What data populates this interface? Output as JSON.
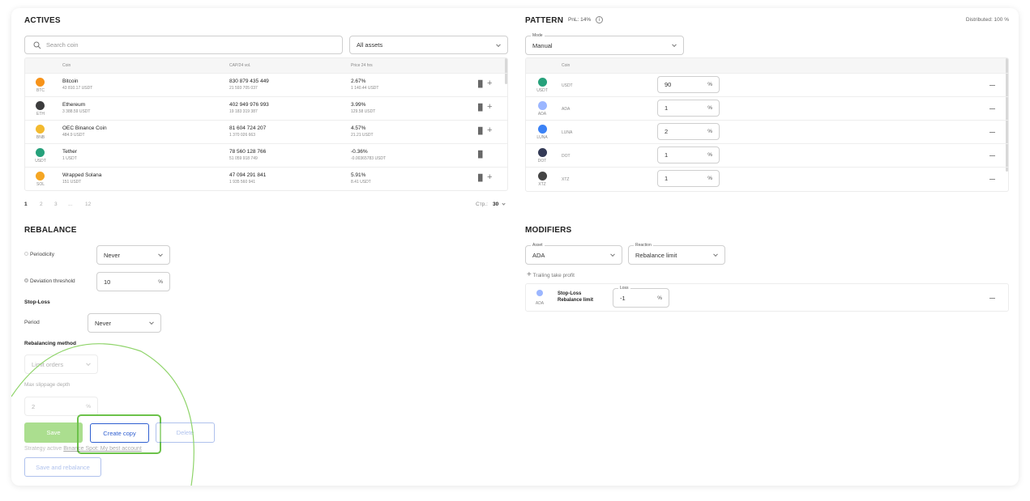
{
  "actives": {
    "title": "ACTIVES",
    "search_placeholder": "Search coin",
    "filter_value": "All assets",
    "columns": {
      "coin": "Coin",
      "cap": "CAP/24 vol.",
      "price": "Price 24 hrs"
    },
    "rows": [
      {
        "symbol": "BTC",
        "name": "Bitcoin",
        "price": "43 810.17 USDT",
        "cap": "830 879 435 449",
        "vol": "21 593 705 037",
        "change": "2.67%",
        "change_abs": "1 140.44 USDT",
        "color": "#f7931a",
        "chart_icon": true
      },
      {
        "symbol": "ETH",
        "name": "Ethereum",
        "price": "3 388.59 USDT",
        "cap": "402 949 976 993",
        "vol": "19 183 319 387",
        "change": "3.99%",
        "change_abs": "129.58 USDT",
        "color": "#3c3c3d",
        "chart_icon": true
      },
      {
        "symbol": "BNB",
        "name": "OEC Binance Coin",
        "price": "484.9 USDT",
        "cap": "81 604 724 207",
        "vol": "1 370 026 663",
        "change": "4.57%",
        "change_abs": "21.21 USDT",
        "color": "#f3ba2f",
        "chart_icon": true
      },
      {
        "symbol": "USDT",
        "name": "Tether",
        "price": "1 USDT",
        "cap": "78 560 128 766",
        "vol": "51 059 918 749",
        "change": "-0.36%",
        "change_abs": "-0.00365783 USDT",
        "color": "#26a17b",
        "chart_icon": false
      },
      {
        "symbol": "SOL",
        "name": "Wrapped Solana",
        "price": "151 USDT",
        "cap": "47 094 291 841",
        "vol": "1 935 560 941",
        "change": "5.91%",
        "change_abs": "8.41 USDT",
        "color": "#f5a623",
        "chart_icon": true
      }
    ],
    "pagination": {
      "p1": "1",
      "p2": "2",
      "p3": "3",
      "dots": "...",
      "last": "12",
      "per_page_label": "Стр.:",
      "per_page": "30"
    }
  },
  "pattern": {
    "title": "PATTERN",
    "pnl": "PnL: 14%",
    "distributed": "Distributed: 100 %",
    "mode_label": "Mode",
    "mode_value": "Manual",
    "coin_col": "Coin",
    "rows": [
      {
        "symbol": "USDT",
        "value": "90",
        "color": "#26a17b"
      },
      {
        "symbol": "ADA",
        "value": "1",
        "color": "#9bb6ff"
      },
      {
        "symbol": "LUNA",
        "value": "2",
        "color": "#3b82f6"
      },
      {
        "symbol": "DOT",
        "value": "1",
        "color": "#333a56"
      },
      {
        "symbol": "XTZ",
        "value": "1",
        "color": "#444444"
      }
    ],
    "pct": "%"
  },
  "rebalance": {
    "title": "REBALANCE",
    "periodicity_label": "Periodicity",
    "periodicity_value": "Never",
    "deviation_label": "Deviation threshold",
    "deviation_value": "10",
    "stoploss_title": "Stop-Loss",
    "period_label": "Period",
    "period_value": "Never",
    "method_title": "Rebalancing method",
    "method_value": "Limit orders",
    "slippage_title": "Max slippage depth",
    "slippage_value": "2",
    "save": "Save",
    "create_copy": "Create copy",
    "delete": "Delete",
    "strategy_active": "Strategy active",
    "account": "Binance Spot: My best account",
    "save_rebalance": "Save and rebalance"
  },
  "modifiers": {
    "title": "MODIFIERS",
    "asset_label": "Asset",
    "asset_value": "ADA",
    "reaction_label": "Reaction",
    "reaction_value": "Rebalance limit",
    "add_trailing": "Trailing take profit",
    "item_symbol": "ADA",
    "item_line1": "Stop-Loss",
    "item_line2": "Rebalance limit",
    "loss_label": "Loss",
    "loss_value": "-1"
  },
  "colors": {
    "accent": "#2f5fd0",
    "highlight": "#7ed957",
    "save": "#8fd46a"
  }
}
